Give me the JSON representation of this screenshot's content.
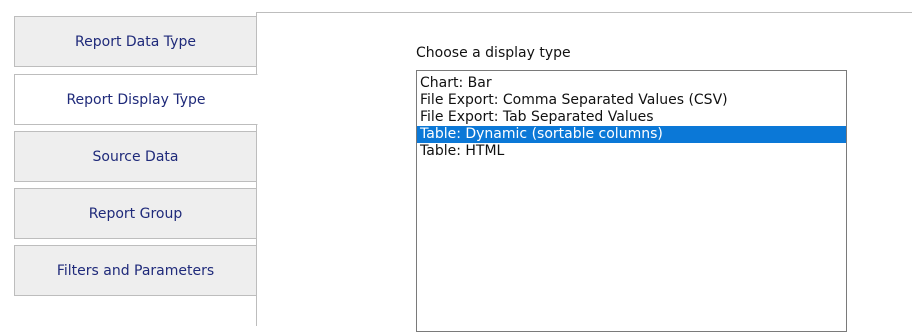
{
  "tabs": [
    {
      "label": "Report Data Type",
      "active": false
    },
    {
      "label": "Report Display Type",
      "active": true
    },
    {
      "label": "Source Data",
      "active": false
    },
    {
      "label": "Report Group",
      "active": false
    },
    {
      "label": "Filters and Parameters",
      "active": false
    }
  ],
  "display_type": {
    "prompt": "Choose a display type",
    "options": [
      "Chart: Bar",
      "File Export: Comma Separated Values (CSV)",
      "File Export: Tab Separated Values",
      "Table: Dynamic (sortable columns)",
      "Table: HTML"
    ],
    "selected": "Table: Dynamic (sortable columns)"
  },
  "colors": {
    "tab_text": "#1f2a7a",
    "selection": "#0b78d7"
  }
}
